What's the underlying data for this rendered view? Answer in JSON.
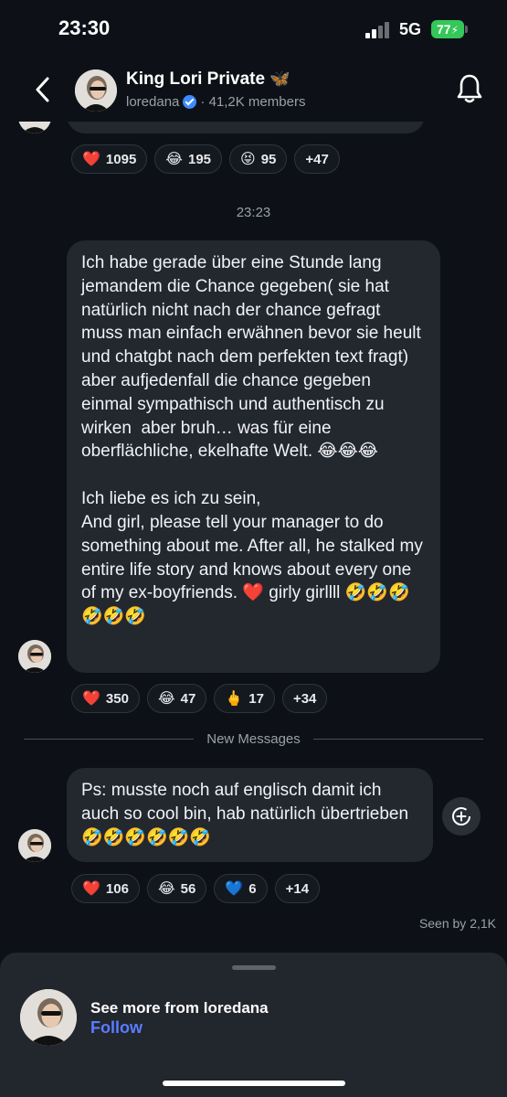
{
  "status_bar": {
    "time": "23:30",
    "network": "5G",
    "battery": "77"
  },
  "header": {
    "title": "King Lori Private",
    "title_emoji": "🦋",
    "username": "loredana",
    "members": "41,2K members",
    "icons": [
      "back-chevron-icon",
      "verified-badge-icon",
      "bell-icon"
    ]
  },
  "top_reactions": [
    {
      "emoji": "❤️",
      "count": "1095"
    },
    {
      "emoji": "😂",
      "count": "195"
    },
    {
      "emoji": "😝",
      "count": "95"
    },
    {
      "emoji": "",
      "count": "+47"
    }
  ],
  "time_separator": "23:23",
  "message1": {
    "paragraph1": "Ich habe gerade über eine Stunde lang jemandem die Chance gegeben( sie hat natürlich nicht nach der chance gefragt muss man einfach erwähnen bevor sie heult und chatgbt nach dem perfekten text fragt) aber aufjedenfall die chance gegeben einmal sympathisch und authentisch zu wirken  aber bruh… was für eine oberflächliche, ekelhafte Welt. 😂😂😂",
    "paragraph2": "Ich liebe es ich zu sein,\nAnd girl, please tell your manager to do something about me. After all, he stalked my entire life story and knows about every one of my ex-boyfriends. ❤️ girly girllll 🤣🤣🤣🤣🤣🤣",
    "reactions": [
      {
        "emoji": "❤️",
        "count": "350"
      },
      {
        "emoji": "😂",
        "count": "47"
      },
      {
        "emoji": "🖕",
        "count": "17"
      },
      {
        "emoji": "",
        "count": "+34"
      }
    ]
  },
  "new_messages_label": "New Messages",
  "message2": {
    "text": "Ps: musste noch auf englisch damit ich auch so cool bin, hab natürlich übertrieben 🤣🤣🤣🤣🤣🤣",
    "reactions": [
      {
        "emoji": "❤️",
        "count": "106"
      },
      {
        "emoji": "😂",
        "count": "56"
      },
      {
        "emoji": "💙",
        "count": "6"
      },
      {
        "emoji": "",
        "count": "+14"
      }
    ]
  },
  "seen_by": "Seen by 2,1K",
  "bottom_sheet": {
    "title": "See more from loredana",
    "follow_label": "Follow"
  },
  "colors": {
    "background": "#0d1117",
    "bubble": "#23272e",
    "accent_follow": "#5a7cff",
    "verified": "#3d8bfd",
    "battery": "#34c759"
  }
}
